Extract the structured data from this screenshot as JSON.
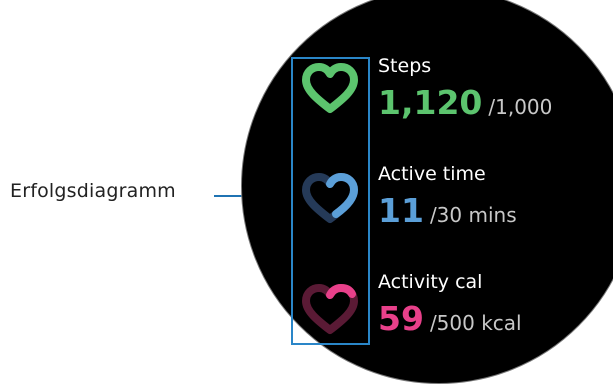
{
  "callout": {
    "label": "Erfolgsdiagramm"
  },
  "colors": {
    "steps": "#5cc46e",
    "active_time": "#5b9fd8",
    "activity_cal": "#e8408a",
    "steps_dim": "#1f4a29",
    "active_time_dim": "#253a58",
    "activity_cal_dim": "#5a1a35",
    "callout_line": "#1f73b3",
    "box": "#2a86c8"
  },
  "metrics": [
    {
      "label": "Steps",
      "value": "1,120",
      "goal": "/1,000",
      "progress": 1.0,
      "icon": "steps-heart-icon"
    },
    {
      "label": "Active time",
      "value": "11",
      "goal": "/30 mins",
      "progress": 0.37,
      "icon": "active-time-heart-icon"
    },
    {
      "label": "Activity cal",
      "value": "59",
      "goal": "/500 kcal",
      "progress": 0.12,
      "icon": "activity-cal-heart-icon"
    }
  ]
}
